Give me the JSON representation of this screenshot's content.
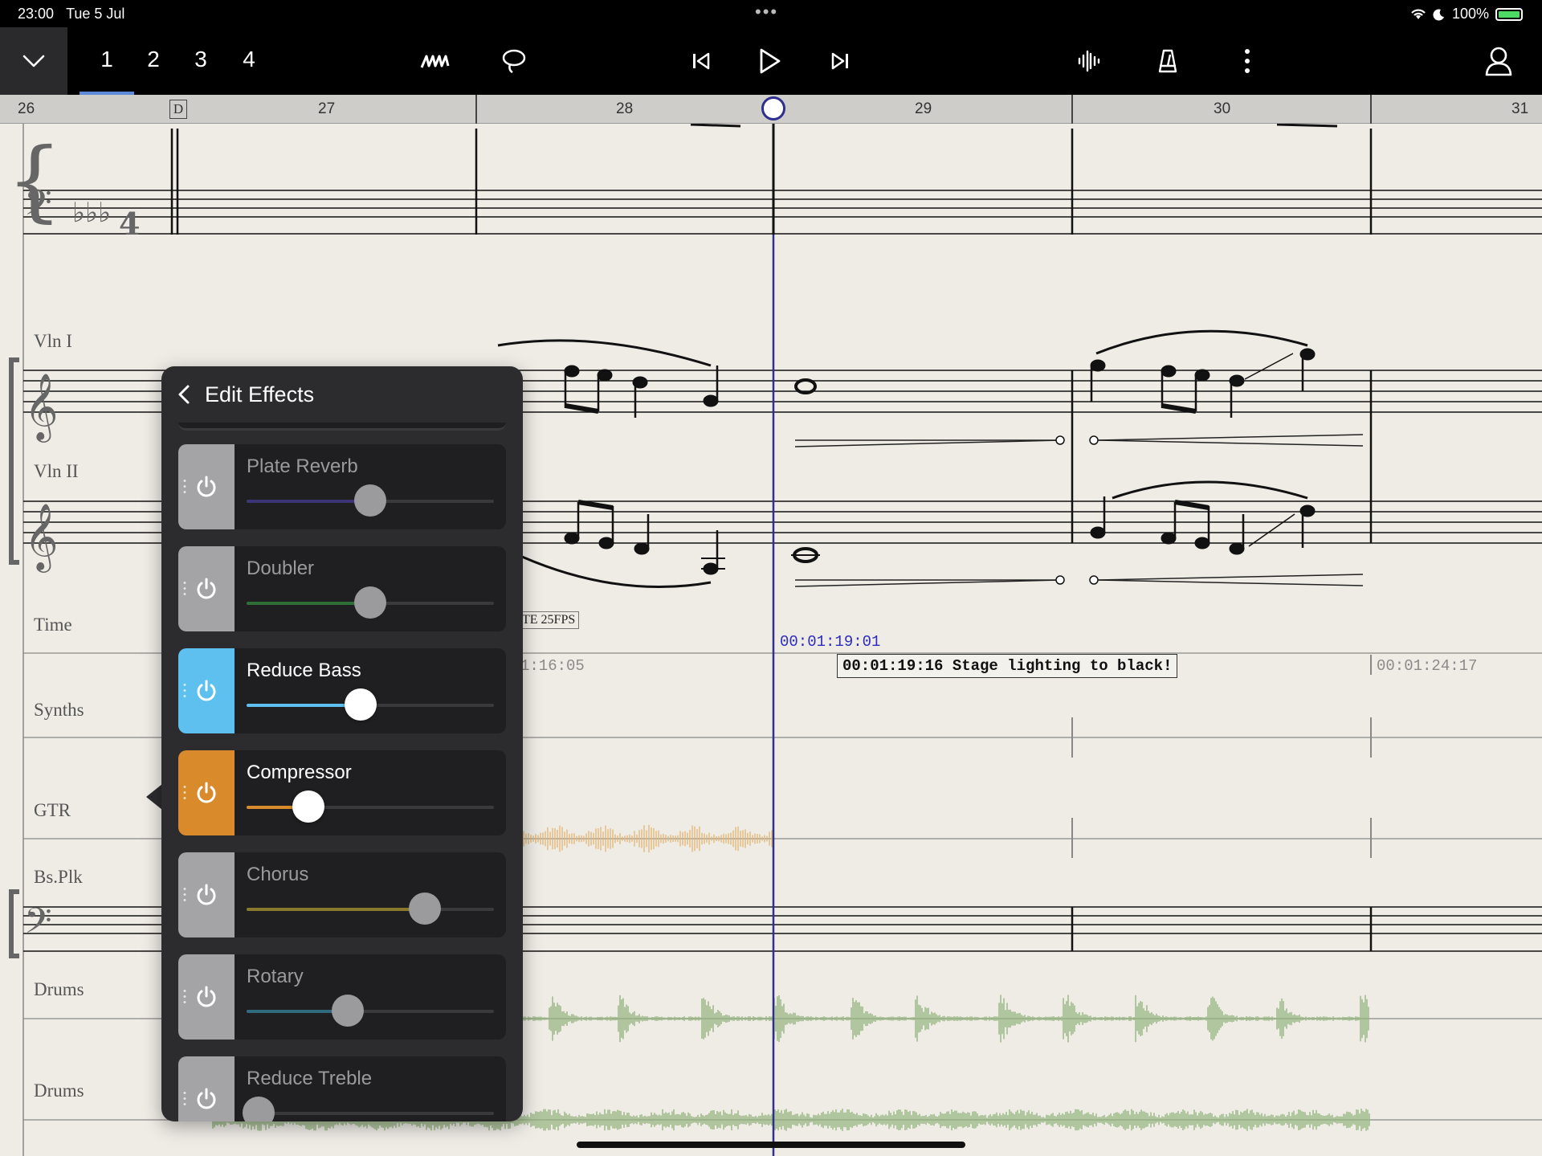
{
  "status_bar": {
    "time": "23:00",
    "date": "Tue 5 Jul",
    "battery": "100%",
    "more": "•••"
  },
  "toolbar": {
    "pages": [
      "1",
      "2",
      "3",
      "4"
    ],
    "active_page": "1",
    "icons": [
      "chevron-down-icon",
      "handwriting-icon",
      "lasso-icon",
      "skip-back-icon",
      "play-icon",
      "skip-forward-icon",
      "waveform-icon",
      "metronome-icon",
      "more-vertical-icon",
      "profile-icon"
    ]
  },
  "ruler": {
    "bars": [
      "26",
      "27",
      "28",
      "29",
      "30",
      "31"
    ],
    "rehearsal_mark": "D"
  },
  "score": {
    "instruments": [
      "Vln I",
      "Vln II",
      "Time",
      "Synths",
      "GTR",
      "Bs.Plk",
      "Drums",
      "Drums"
    ],
    "smpte": "TE 25FPS",
    "timecode_left": "1:16:05",
    "timecode_current": "00:01:19:01",
    "timecode_right": "00:01:24:17",
    "cue": "00:01:19:16 Stage lighting to black!",
    "key": "E-flat major",
    "time_signature": "4/4"
  },
  "panel": {
    "title": "Edit Effects",
    "effects": [
      {
        "name": "Plate Reverb",
        "on": false,
        "value": 0.5,
        "color": "#3c3575",
        "btn": "#a4a4a6"
      },
      {
        "name": "Doubler",
        "on": false,
        "value": 0.5,
        "color": "#2f6e36",
        "btn": "#a4a4a6"
      },
      {
        "name": "Reduce Bass",
        "on": true,
        "value": 0.46,
        "color": "#5ec0ee",
        "btn": "#5ec0ee"
      },
      {
        "name": "Compressor",
        "on": true,
        "value": 0.25,
        "color": "#d98a2b",
        "btn": "#d98a2b"
      },
      {
        "name": "Chorus",
        "on": false,
        "value": 0.72,
        "color": "#8a7a2e",
        "btn": "#a4a4a6"
      },
      {
        "name": "Rotary",
        "on": false,
        "value": 0.41,
        "color": "#2f6b7c",
        "btn": "#a4a4a6"
      },
      {
        "name": "Reduce Treble",
        "on": false,
        "value": 0.05,
        "color": "#555555",
        "btn": "#a4a4a6"
      }
    ]
  }
}
